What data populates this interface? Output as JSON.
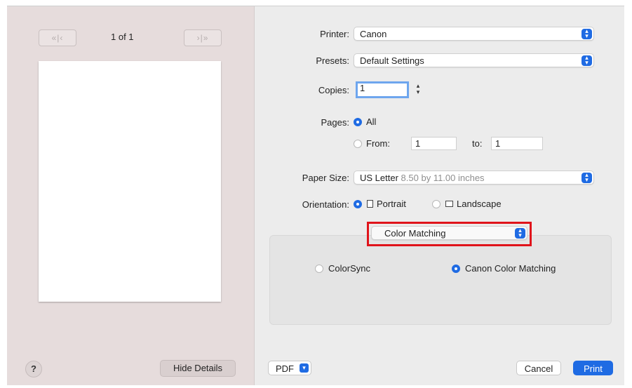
{
  "preview": {
    "first_prev_label": "«|‹",
    "next_last_label": "›|»",
    "page_count": "1 of 1",
    "help_label": "?",
    "hide_details_label": "Hide Details"
  },
  "printer": {
    "label": "Printer:",
    "value": "Canon"
  },
  "presets": {
    "label": "Presets:",
    "value": "Default Settings"
  },
  "copies": {
    "label": "Copies:",
    "value": "1"
  },
  "pages": {
    "label": "Pages:",
    "all_label": "All",
    "from_label": "From:",
    "from_value": "1",
    "to_label": "to:",
    "to_value": "1",
    "selected": "All"
  },
  "paper_size": {
    "label": "Paper Size:",
    "value": "US Letter",
    "detail": "8.50 by 11.00 inches"
  },
  "orientation": {
    "label": "Orientation:",
    "portrait_label": "Portrait",
    "landscape_label": "Landscape",
    "selected": "Portrait"
  },
  "section_popup": {
    "value": "Color Matching"
  },
  "color_matching": {
    "colorsync_label": "ColorSync",
    "canon_label": "Canon Color Matching",
    "selected": "Canon Color Matching"
  },
  "footer": {
    "pdf_label": "PDF",
    "cancel_label": "Cancel",
    "print_label": "Print"
  },
  "colors": {
    "accent": "#1f6be3",
    "highlight": "#e0141b",
    "sidebar": "#e6dcdc"
  }
}
